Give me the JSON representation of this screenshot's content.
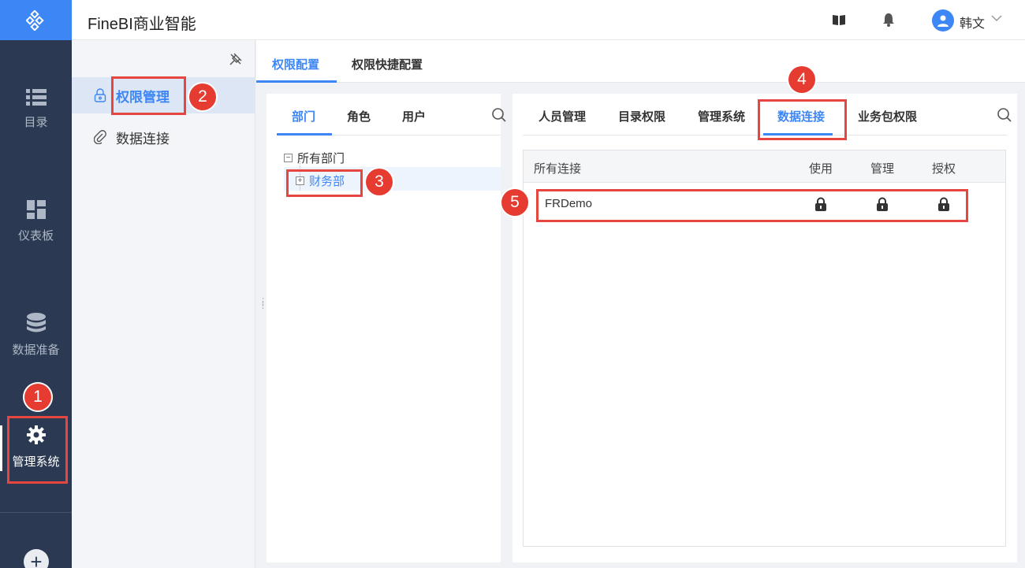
{
  "app": {
    "title": "FineBI商业智能"
  },
  "user": {
    "name": "韩文"
  },
  "leftnav": {
    "items": [
      {
        "label": "目录",
        "icon": "list-icon"
      },
      {
        "label": "仪表板",
        "icon": "dashboard-icon"
      },
      {
        "label": "数据准备",
        "icon": "database-icon"
      },
      {
        "label": "管理系统",
        "icon": "gear-icon",
        "active": true
      }
    ]
  },
  "subnav": {
    "items": [
      {
        "label": "权限管理",
        "icon": "lock-icon",
        "active": true
      },
      {
        "label": "数据连接",
        "icon": "paperclip-icon"
      }
    ]
  },
  "toptabs": [
    {
      "label": "权限配置",
      "active": true
    },
    {
      "label": "权限快捷配置"
    }
  ],
  "left_tabs": [
    {
      "label": "部门",
      "active": true
    },
    {
      "label": "角色"
    },
    {
      "label": "用户"
    }
  ],
  "tree": {
    "root": "所有部门",
    "children": [
      {
        "label": "财务部"
      }
    ]
  },
  "right_tabs": [
    {
      "label": "人员管理"
    },
    {
      "label": "目录权限"
    },
    {
      "label": "管理系统"
    },
    {
      "label": "数据连接",
      "active": true
    },
    {
      "label": "业务包权限"
    }
  ],
  "table": {
    "headers": [
      "所有连接",
      "使用",
      "管理",
      "授权"
    ],
    "rows": [
      {
        "name": "FRDemo",
        "use": "locked",
        "manage": "locked",
        "grant": "locked"
      }
    ]
  },
  "annotations": [
    "1",
    "2",
    "3",
    "4",
    "5"
  ],
  "colors": {
    "accent": "#3d86f5",
    "nav_bg": "#2b3a52",
    "highlight": "#e64540"
  }
}
